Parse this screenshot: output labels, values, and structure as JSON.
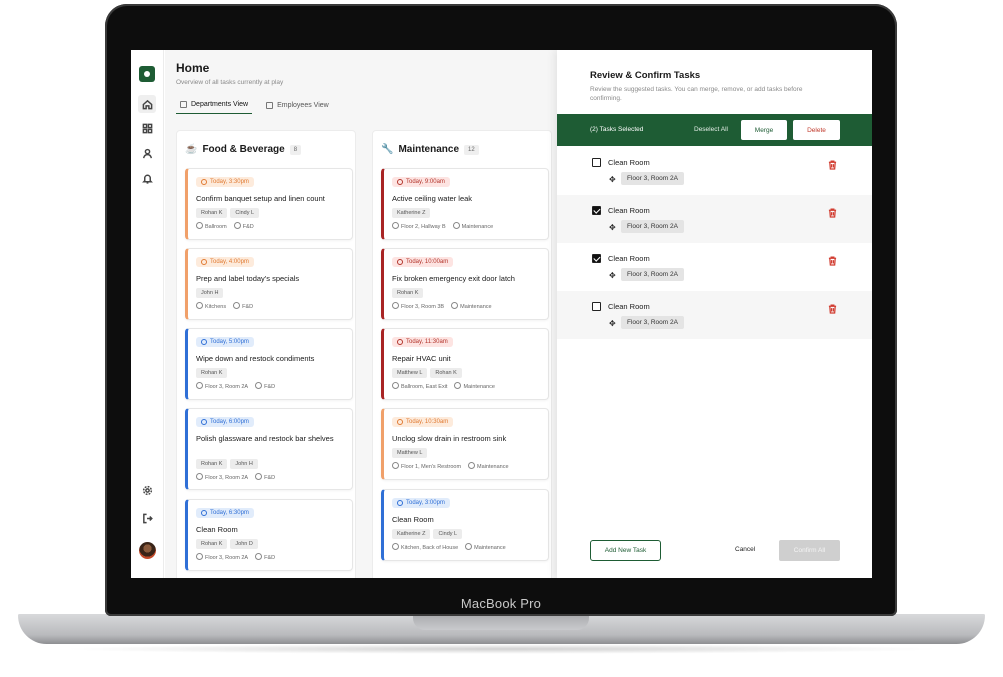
{
  "device": {
    "brand": "MacBook Pro"
  },
  "header": {
    "title": "Home",
    "subtitle": "Overview of all tasks currently at play"
  },
  "tabs": [
    {
      "label": "Departments View",
      "active": true
    },
    {
      "label": "Employees View",
      "active": false
    }
  ],
  "sidebar": {
    "items": [
      {
        "icon": "home-icon",
        "active": true
      },
      {
        "icon": "grid-icon",
        "active": false
      },
      {
        "icon": "user-icon",
        "active": false
      },
      {
        "icon": "bell-icon",
        "active": false
      },
      {
        "icon": "gear-icon",
        "active": false
      },
      {
        "icon": "logout-icon",
        "active": false
      }
    ]
  },
  "columns": [
    {
      "name": "Food & Beverage",
      "icon": "food-icon",
      "count": "8",
      "cards": [
        {
          "time": "Today, 3:30pm",
          "priority": "orange",
          "title": "Confirm banquet setup and linen count",
          "people": [
            "Rohan K",
            "Cindy L"
          ],
          "location": "Ballroom",
          "dept": "F&D"
        },
        {
          "time": "Today, 4:00pm",
          "priority": "orange",
          "title": "Prep and label today's specials",
          "people": [
            "John H"
          ],
          "location": "Kitchens",
          "dept": "F&D"
        },
        {
          "time": "Today, 5:00pm",
          "priority": "blue",
          "title": "Wipe down and restock condiments",
          "people": [
            "Rohan K"
          ],
          "location": "Floor 3, Room 2A",
          "dept": "F&D"
        },
        {
          "time": "Today, 6:00pm",
          "priority": "blue",
          "title": "Polish glassware and restock bar shelves",
          "people": [
            "Rohan K",
            "John H"
          ],
          "location": "Floor 3, Room 2A",
          "dept": "F&D"
        },
        {
          "time": "Today, 6:30pm",
          "priority": "blue",
          "title": "Clean Room",
          "people": [
            "Rohan K",
            "John D"
          ],
          "location": "Floor 3, Room 2A",
          "dept": "F&D"
        }
      ]
    },
    {
      "name": "Maintenance",
      "icon": "wrench-icon",
      "count": "12",
      "cards": [
        {
          "time": "Today, 9:00am",
          "priority": "red",
          "title": "Active ceiling water leak",
          "people": [
            "Katherine Z"
          ],
          "location": "Floor 2, Hallway B",
          "dept": "Maintenance"
        },
        {
          "time": "Today, 10:00am",
          "priority": "red",
          "title": "Fix broken emergency exit door latch",
          "people": [
            "Rohan K"
          ],
          "location": "Floor 3, Room 3B",
          "dept": "Maintenance"
        },
        {
          "time": "Today, 11:30am",
          "priority": "red",
          "title": "Repair HVAC unit",
          "people": [
            "Matthew L",
            "Rohan K"
          ],
          "location": "Ballroom, East Exit",
          "dept": "Maintenance"
        },
        {
          "time": "Today, 10:30am",
          "priority": "orange",
          "title": "Unclog slow drain in restroom sink",
          "people": [
            "Matthew L"
          ],
          "location": "Floor 1, Men's Restroom",
          "dept": "Maintenance"
        },
        {
          "time": "Today, 3:00pm",
          "priority": "blue",
          "title": "Clean Room",
          "people": [
            "Katherine Z",
            "Cindy L"
          ],
          "location": "Kitchen, Back of House",
          "dept": "Maintenance"
        }
      ]
    }
  ],
  "panel": {
    "title": "Review & Confirm Tasks",
    "subtitle": "Review the suggested tasks. You can merge, remove, or add tasks before confirming.",
    "selection_label": "(2) Tasks Selected",
    "deselect_label": "Deselect All",
    "merge_label": "Merge",
    "delete_label": "Delete",
    "tasks": [
      {
        "title": "Clean Room",
        "location": "Floor 3, Room 2A",
        "checked": false
      },
      {
        "title": "Clean Room",
        "location": "Floor 3, Room 2A",
        "checked": true
      },
      {
        "title": "Clean Room",
        "location": "Floor 3, Room 2A",
        "checked": true
      },
      {
        "title": "Clean Room",
        "location": "Floor 3, Room 2A",
        "checked": false
      }
    ],
    "add_label": "Add New Task",
    "cancel_label": "Cancel",
    "confirm_label": "Confirm All"
  },
  "colors": {
    "brand": "#1e5c34",
    "red": "#a82424",
    "orange": "#f0a06a",
    "blue": "#2f6fd6"
  }
}
